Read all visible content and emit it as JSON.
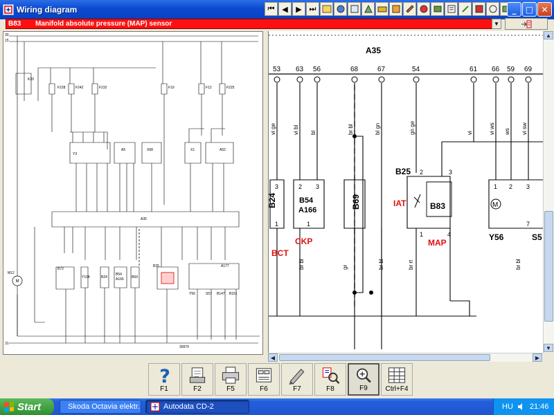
{
  "window": {
    "title": "Wiring diagram"
  },
  "toolbar_icons": [
    "first-page-icon",
    "previous-page-icon",
    "next-page-icon",
    "last-page-icon",
    "tool-icon-1",
    "tool-icon-2",
    "tool-icon-3",
    "tool-icon-4",
    "tool-icon-5",
    "tool-icon-6",
    "tool-icon-7",
    "tool-icon-8",
    "tool-icon-9",
    "tool-icon-10",
    "tool-icon-11",
    "tool-icon-12",
    "tool-icon-13",
    "tool-icon-14"
  ],
  "component_bar": {
    "code": "B83",
    "name": "Manifold absolute pressure (MAP) sensor",
    "color": "#ff1010"
  },
  "left_diagram": {
    "labels": {
      "l30": "30",
      "l15": "15",
      "l31": "31",
      "k20": "K20",
      "f228": "F228",
      "f242": "F242",
      "f232": "F232",
      "f19": "F19",
      "f12": "F12",
      "f225": "F225",
      "y3": "Y3",
      "a5": "A5",
      "x68": "X68",
      "x1": "X1",
      "a52": "A52",
      "a35": "A35",
      "m12": "M12",
      "b72": "B72",
      "y104": "Y104",
      "b24": "B24",
      "b54": "B54",
      "a166": "A166",
      "b69": "B69",
      "b25": "B25",
      "a177": "A177",
      "y56": "Y56",
      "s57": "S57",
      "b147": "B147",
      "b151": "B151",
      "ref": "30970"
    }
  },
  "right_diagram": {
    "connector": "A35",
    "pins": [
      "53",
      "63",
      "56",
      "68",
      "67",
      "54",
      "61",
      "66",
      "59",
      "69"
    ],
    "wires": [
      "vi ge",
      "vi bl",
      "bl",
      "br bl",
      "bl gn",
      "gn ge",
      "vi",
      "vi ws",
      "ws",
      "vi sw"
    ],
    "labels": {
      "b24": "B24",
      "b54": "B54",
      "a166": "A166",
      "b69": "B69",
      "b25": "B25",
      "b83": "B83",
      "y56": "Y56",
      "s5": "S5",
      "p3a": "3",
      "p1a": "1",
      "p2b": "2",
      "p3b": "3",
      "p1b": "1",
      "p2c": "2",
      "p3c": "3",
      "p1c": "1",
      "p4c": "4",
      "p1d": "1",
      "p2d": "2",
      "p3d": "3",
      "p7d": "7",
      "w_br_bl": "br bl",
      "w_gr": "gr",
      "w_br_bl2": "br bl",
      "w_br_rt": "br rt",
      "w_br_bl3": "br bl",
      "w_br_bl4": "br bl"
    },
    "callouts": {
      "bct": "BCT",
      "ckp": "CKP",
      "iat": "IAT",
      "map": "MAP"
    },
    "callout_color": "#e01010"
  },
  "function_keys": [
    {
      "label": "F1",
      "icon": "help-icon"
    },
    {
      "label": "F2",
      "icon": "print-preview-icon"
    },
    {
      "label": "F5",
      "icon": "printer-icon"
    },
    {
      "label": "F6",
      "icon": "component-list-icon"
    },
    {
      "label": "F7",
      "icon": "pen-icon"
    },
    {
      "label": "F8",
      "icon": "zoom-area-icon"
    },
    {
      "label": "F9",
      "icon": "zoom-magnifier-icon"
    },
    {
      "label": "Ctrl+F4",
      "icon": "grid-icon"
    }
  ],
  "taskbar": {
    "start_label": "Start",
    "tasks": [
      {
        "label": "Skoda Octavia elektr..."
      },
      {
        "label": "Autodata CD-2"
      }
    ],
    "lang": "HU",
    "clock": "21:46"
  }
}
